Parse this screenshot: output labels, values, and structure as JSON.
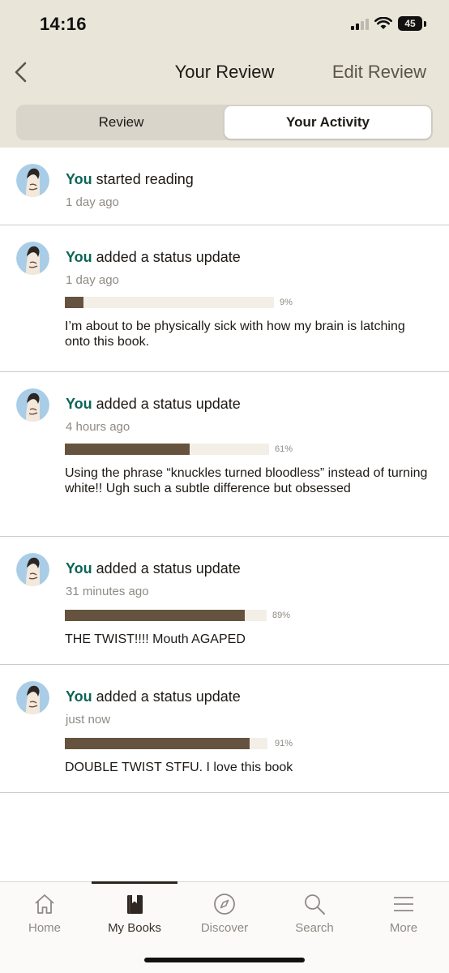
{
  "status_bar": {
    "time": "14:16",
    "battery": "45"
  },
  "nav": {
    "title": "Your Review",
    "edit_label": "Edit Review"
  },
  "segments": {
    "review": "Review",
    "activity": "Your Activity"
  },
  "feed": [
    {
      "you": "You",
      "action": " started reading",
      "time": "1 day ago"
    },
    {
      "you": "You",
      "action": " added a status update",
      "time": "1 day ago",
      "progress": 9,
      "progress_label": "9%",
      "text": "I’m about to be physically sick with how my brain is latching onto this book."
    },
    {
      "you": "You",
      "action": " added a status update",
      "time": "4 hours ago",
      "progress": 61,
      "progress_label": "61%",
      "text": "Using the phrase “knuckles turned bloodless” instead of turning white!! Ugh such a subtle difference but obsessed"
    },
    {
      "you": "You",
      "action": " added a status update",
      "time": "31 minutes ago",
      "progress": 89,
      "progress_label": "89%",
      "text": "THE TWIST!!!! Mouth AGAPED"
    },
    {
      "you": "You",
      "action": " added a status update",
      "time": "just now",
      "progress": 91,
      "progress_label": "91%",
      "text": "DOUBLE TWIST STFU. I love this book"
    }
  ],
  "tabs": [
    {
      "label": "Home",
      "icon": "home-icon"
    },
    {
      "label": "My Books",
      "icon": "book-icon"
    },
    {
      "label": "Discover",
      "icon": "compass-icon"
    },
    {
      "label": "Search",
      "icon": "search-icon"
    },
    {
      "label": "More",
      "icon": "menu-icon"
    }
  ],
  "colors": {
    "accent_you": "#0c6556",
    "header_bg": "#e9e5d9",
    "progress_fill": "#66533f",
    "progress_track": "#f3efe6"
  }
}
